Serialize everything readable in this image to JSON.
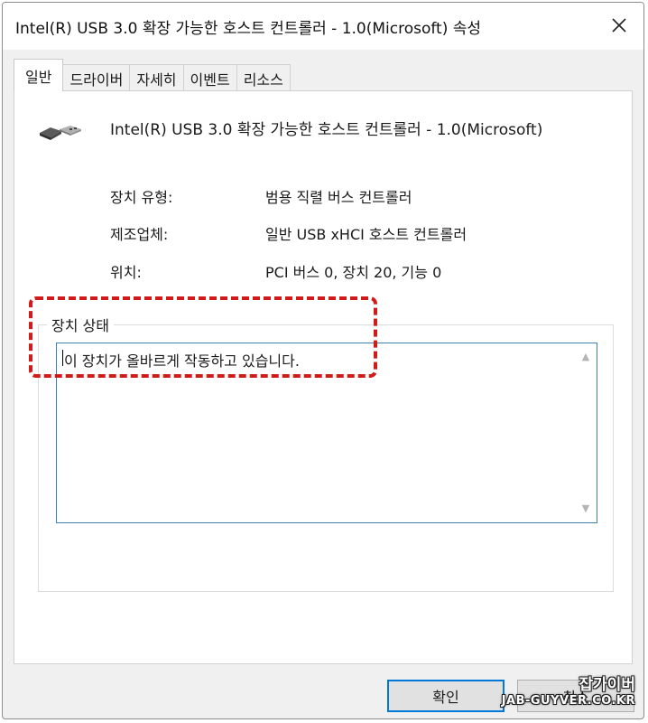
{
  "window": {
    "title": "Intel(R) USB 3.0 확장 가능한 호스트 컨트롤러 - 1.0(Microsoft) 속성",
    "close_icon": "close-icon"
  },
  "tabs": [
    {
      "label": "일반",
      "active": true
    },
    {
      "label": "드라이버",
      "active": false
    },
    {
      "label": "자세히",
      "active": false
    },
    {
      "label": "이벤트",
      "active": false
    },
    {
      "label": "리소스",
      "active": false
    }
  ],
  "device": {
    "icon": "usb-connector-icon",
    "name": "Intel(R) USB 3.0 확장 가능한 호스트 컨트롤러 - 1.0(Microsoft)"
  },
  "properties": [
    {
      "label": "장치 유형:",
      "value": "범용 직렬 버스 컨트롤러"
    },
    {
      "label": "제조업체:",
      "value": "일반 USB xHCI 호스트 컨트롤러"
    },
    {
      "label": "위치:",
      "value": "PCI 버스 0, 장치 20, 기능 0"
    }
  ],
  "status": {
    "group_label": "장치 상태",
    "text": "이 장치가 올바르게 작동하고 있습니다."
  },
  "buttons": {
    "ok": "확인",
    "cancel": "취소"
  },
  "watermark": {
    "line1": "잡가이버",
    "line2": "JAB-GUYVER.CO.KR"
  },
  "colors": {
    "highlight": "#d11a1a",
    "focus_border": "#0078d7"
  }
}
